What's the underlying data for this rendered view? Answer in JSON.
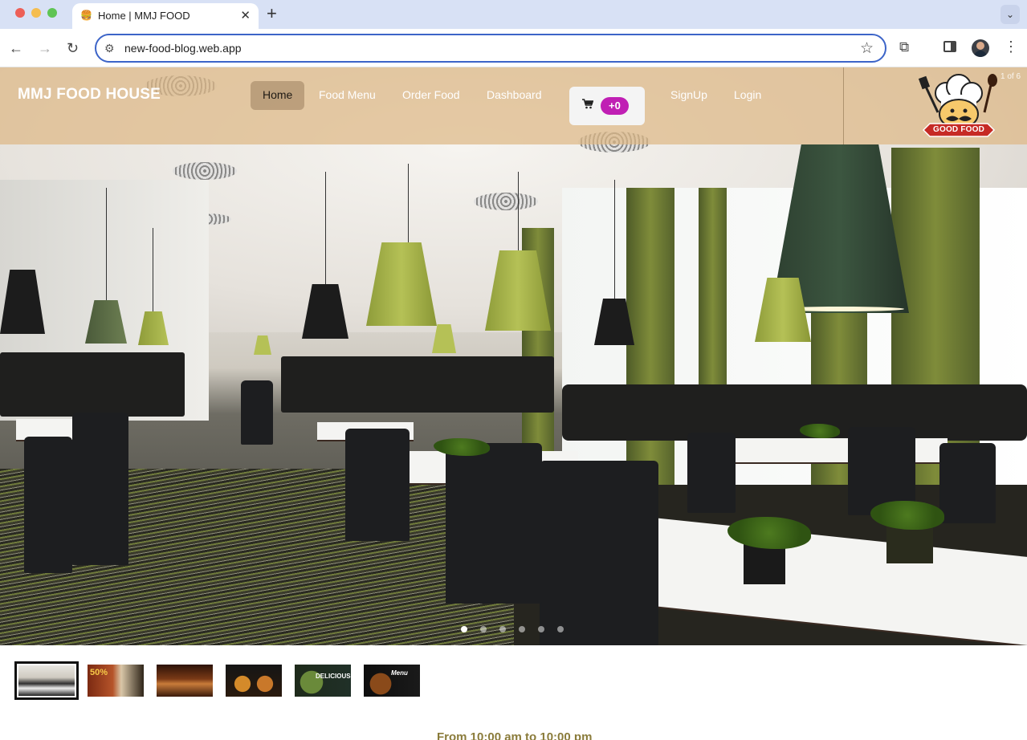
{
  "browser": {
    "tab_title": "Home | MMJ FOOD",
    "tab_favicon": "🍔",
    "tab_close": "✕",
    "new_tab": "+",
    "tab_search": "⌄",
    "url": "new-food-blog.web.app",
    "back": "←",
    "forward": "→",
    "reload": "↻",
    "site_info": "⚙",
    "star": "☆",
    "extensions": "⧉",
    "menu": "⋮"
  },
  "site": {
    "brand": "MMJ FOOD HOUSE",
    "nav": [
      {
        "label": "Home",
        "active": true
      },
      {
        "label": "Food Menu"
      },
      {
        "label": "Order Food"
      },
      {
        "label": "Dashboard"
      },
      {
        "label": "SignUp"
      },
      {
        "label": "Login"
      }
    ],
    "cart_icon": "🛒",
    "cart_count": "+0",
    "slide_counter": "1 of 6",
    "logo_text": "GOOD FOOD"
  },
  "carousel": {
    "slide_count": 6,
    "active_slide": 1,
    "thumbnails": [
      {
        "caption": ""
      },
      {
        "caption": "50%"
      },
      {
        "caption": ""
      },
      {
        "caption": ""
      },
      {
        "caption": "DELICIOUS"
      },
      {
        "caption": "Menu"
      }
    ]
  },
  "footer_peek": "From 10:00 am to 10:00 pm",
  "colors": {
    "nav_overlay": "#deb887",
    "cart_badge": "#c01fb4",
    "omnibox_border": "#3c64c8"
  }
}
